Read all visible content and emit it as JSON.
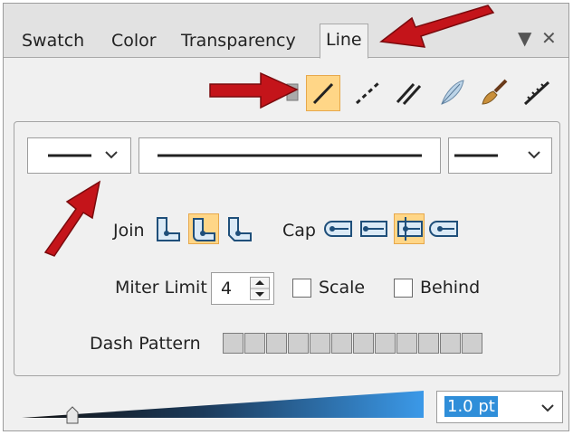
{
  "tabs": [
    "Swatch",
    "Color",
    "Transparency",
    "Line"
  ],
  "window_controls": {
    "menu_icon": "▼",
    "close_icon": "✕"
  },
  "toolbar": {
    "selected_index": 1,
    "icons": [
      "color-icon",
      "solid-line-icon",
      "dashed-line-icon",
      "double-line-icon",
      "feather-icon",
      "brush-icon",
      "ruler-icon"
    ]
  },
  "line_style": {
    "start": "start-line-dropdown",
    "end": "end-line-dropdown"
  },
  "join": {
    "label": "Join",
    "options": [
      "miter-join-icon",
      "round-join-icon",
      "bevel-join-icon"
    ],
    "selected_index": 1
  },
  "cap": {
    "label": "Cap",
    "options": [
      "butt-cap-icon",
      "round-cap-icon",
      "square-cap-icon",
      "projecting-cap-icon"
    ],
    "selected_index": 2
  },
  "miter": {
    "label": "Miter Limit",
    "value": "4"
  },
  "scale": {
    "label": "Scale",
    "checked": false
  },
  "behind": {
    "label": "Behind",
    "checked": false
  },
  "dash": {
    "label": "Dash Pattern",
    "cells": 12
  },
  "width": {
    "value": "1.0 pt"
  },
  "accent": "#2f8ed9"
}
